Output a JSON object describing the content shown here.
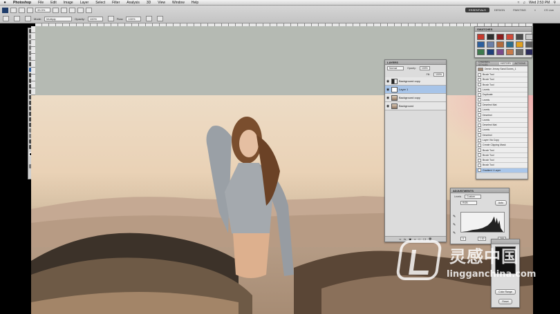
{
  "menubar": {
    "apple": "",
    "items": [
      "Photoshop",
      "File",
      "Edit",
      "Image",
      "Layer",
      "Select",
      "Filter",
      "Analysis",
      "3D",
      "View",
      "Window",
      "Help"
    ],
    "clock": "Wed 2:53 PM"
  },
  "options": {
    "zoom": "33.3%",
    "mode_label": "Mode:",
    "mode_value": "Multiply",
    "opacity_label": "Opacity:",
    "opacity_value": "100%",
    "flow_label": "Flow:",
    "flow_value": "100%",
    "workspaces": [
      "ESSENTIALS",
      "DESIGN",
      "PAINTING"
    ],
    "active_workspace": "ESSENTIALS",
    "cslive": "CS Live"
  },
  "swatches_panel": {
    "title": "SWATCHES",
    "colors": [
      "#c63a2e",
      "#2f2f2f",
      "#8b1e1e",
      "#d04a3a",
      "#4a4a4a",
      "#c8c8c8",
      "#2c5f9e",
      "#6a7fa8",
      "#b06a3c",
      "#2b6d8d",
      "#e0a020",
      "#5a5a5a",
      "#3e7a4e",
      "#1f3f7a",
      "#7a4a8a",
      "#c87a4a",
      "#6a6a6a",
      "#2b2b5a"
    ]
  },
  "layers_panel": {
    "title": "LAYERS",
    "blend_mode": "Normal",
    "opacity_label": "Opacity:",
    "opacity_value": "100%",
    "fill_label": "Fill:",
    "fill_value": "100%",
    "layers": [
      {
        "name": "Background copy",
        "thumb": "dark"
      },
      {
        "name": "Layer 1",
        "thumb": "white"
      },
      {
        "name": "Background copy",
        "thumb": "photo"
      },
      {
        "name": "Background",
        "thumb": "photo"
      }
    ]
  },
  "history_panel": {
    "tabs": [
      "CHANNEL STYLES",
      "HISTORY",
      "ACTIONS"
    ],
    "active_tab": "HISTORY",
    "snapshot": "Denim Jersey Sand Dunes_1",
    "steps": [
      "Brush Tool",
      "Brush Tool",
      "Brush Tool",
      "Levels",
      "Duplicate",
      "Levels",
      "Deselect Mat",
      "Levels",
      "Deselect",
      "Levels",
      "Deselect Mat",
      "Levels",
      "Deselect",
      "Layer Via Copy",
      "Create Clipping Mask",
      "Brush Tool",
      "Brush Tool",
      "Brush Tool",
      "Brush Tool",
      "Gradient 1 Layer"
    ],
    "selected_index": 19
  },
  "adjustments_panel": {
    "title": "ADJUSTMENTS",
    "preset_label": "Levels",
    "preset_value": "Custom",
    "channel_value": "RGB",
    "auto_button": "Auto",
    "inputs": [
      "0",
      "1.00",
      "255"
    ]
  },
  "small_panel": {
    "button_merge": "Color Range",
    "button_reset": "Reset"
  },
  "watermark": {
    "cn": "灵感中国",
    "url": "lingganchina.com"
  }
}
